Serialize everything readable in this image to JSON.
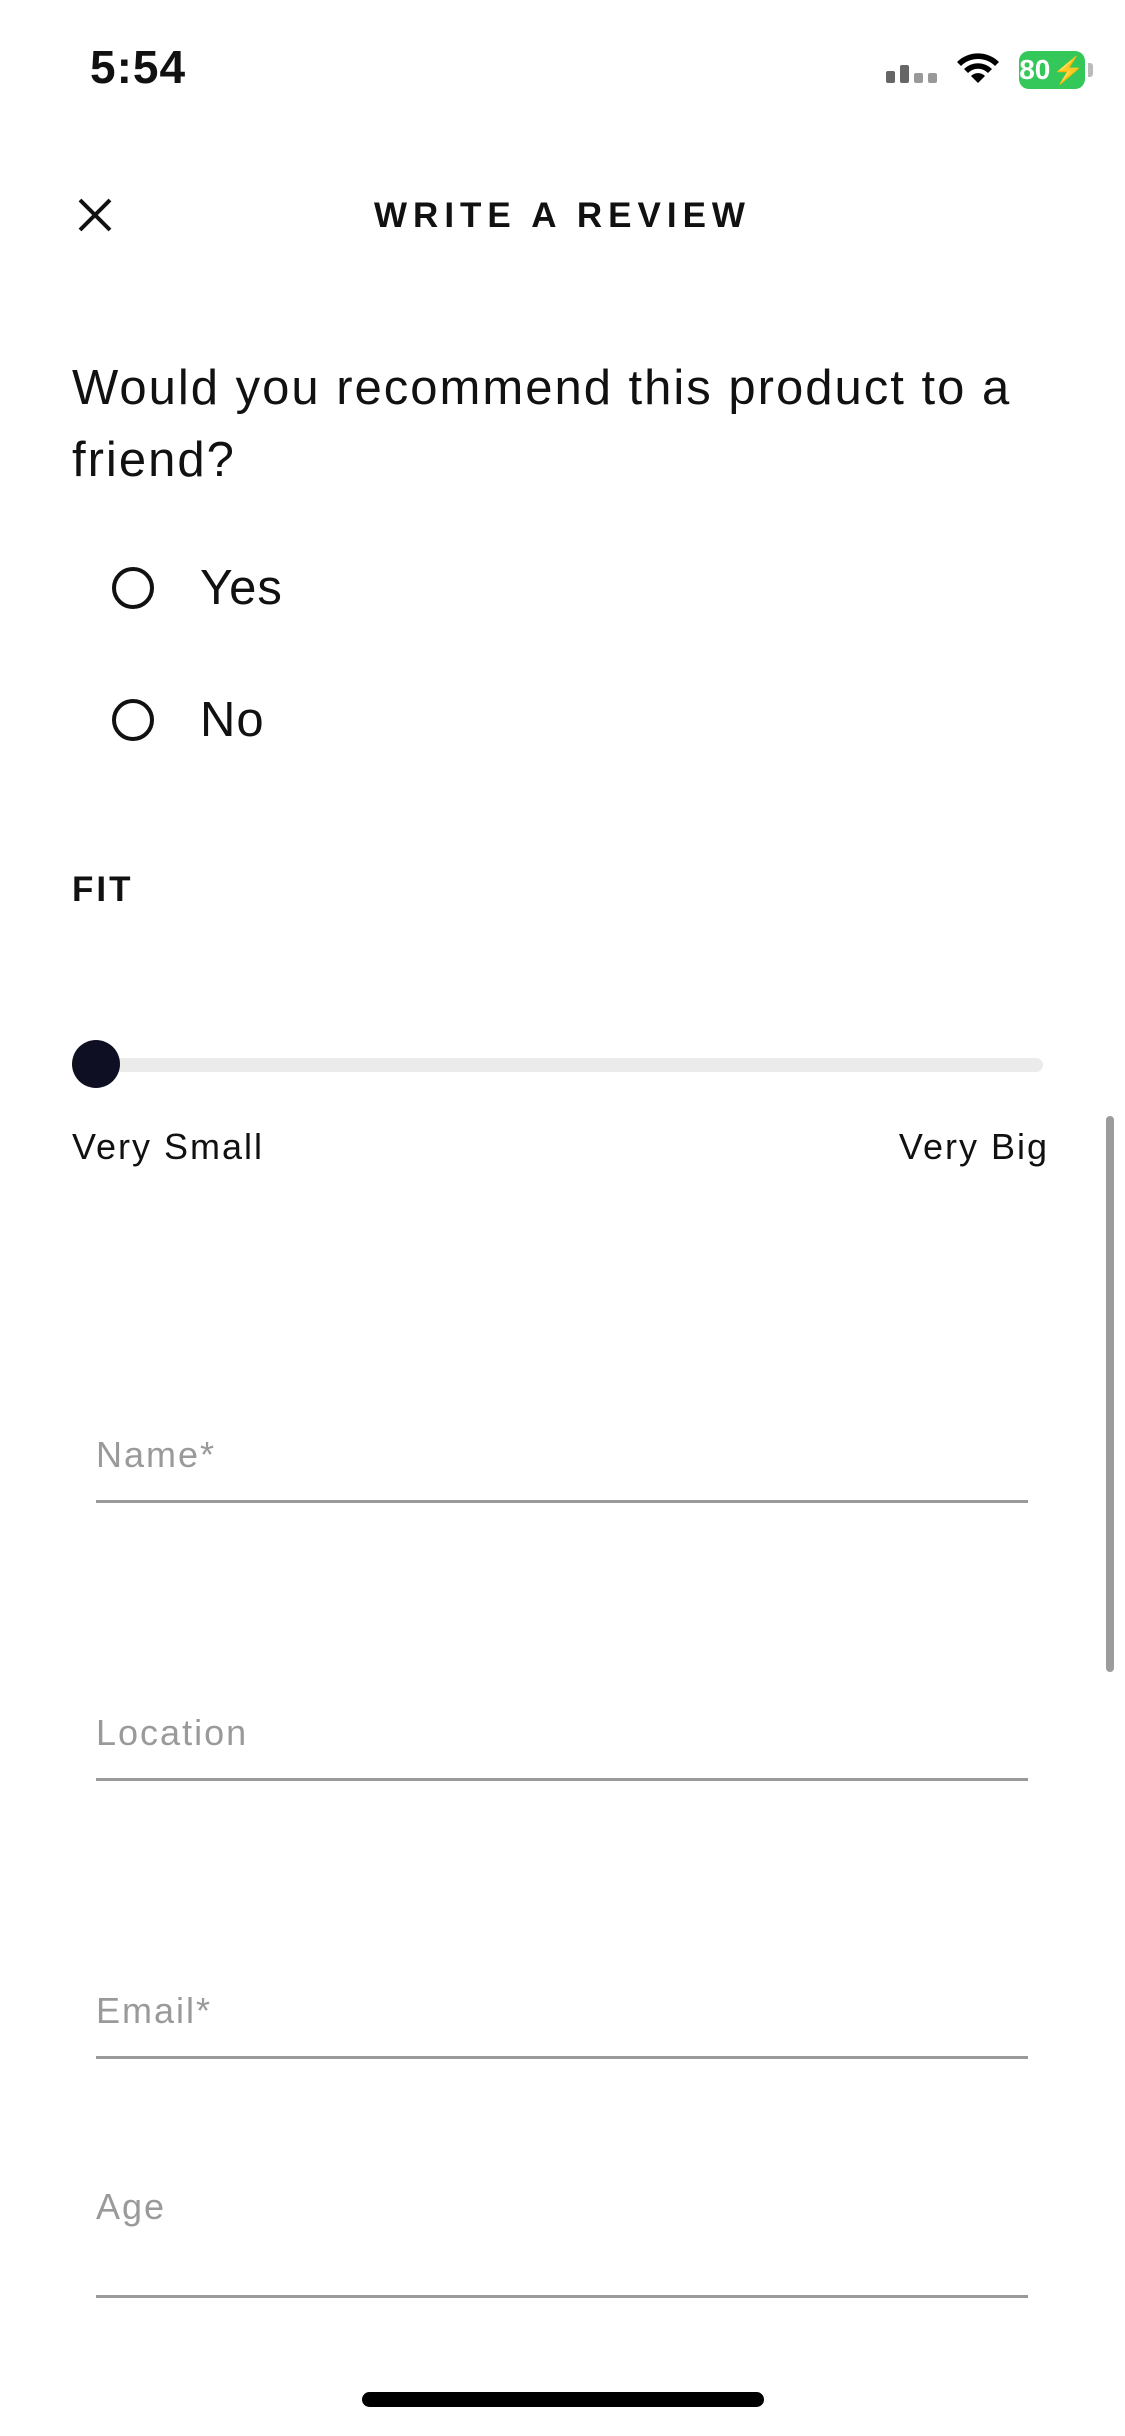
{
  "status_bar": {
    "time": "5:54",
    "battery": "80"
  },
  "header": {
    "title": "WRITE A REVIEW"
  },
  "recommend": {
    "question": "Would you recommend this product to a friend?",
    "options": [
      {
        "label": "Yes",
        "selected": false
      },
      {
        "label": "No",
        "selected": false
      }
    ]
  },
  "fit": {
    "label": "FIT",
    "min_label": "Very Small",
    "max_label": "Very Big",
    "value": 0,
    "thumb_color": "#0f0f23"
  },
  "form": {
    "name_placeholder": "Name*",
    "location_placeholder": "Location",
    "email_placeholder": "Email*",
    "age_placeholder": "Age"
  },
  "colors": {
    "battery": "#34c759",
    "field_line": "#9a9a9a"
  }
}
